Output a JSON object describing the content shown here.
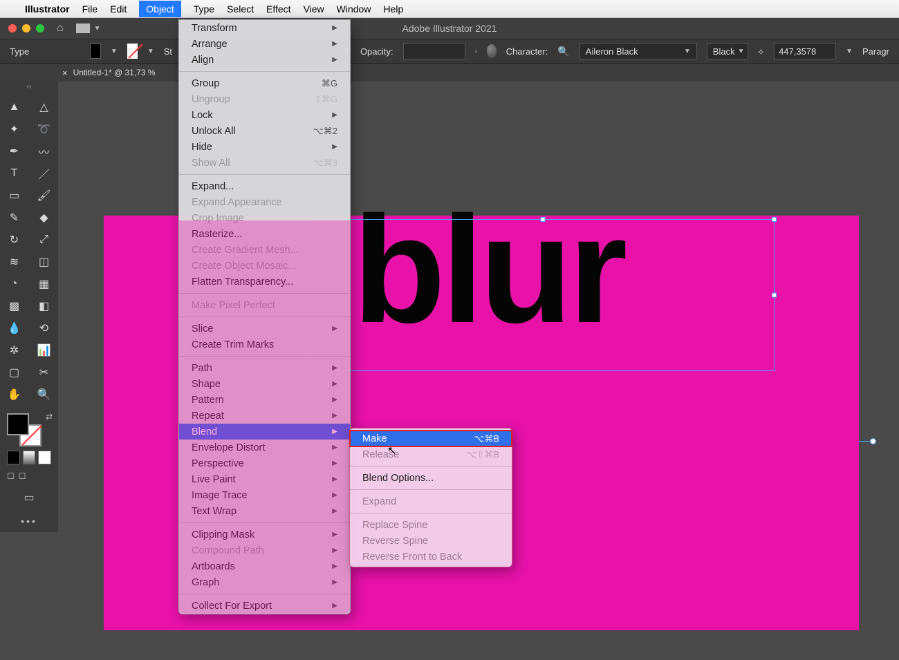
{
  "menubar": {
    "app": "Illustrator",
    "items": [
      "File",
      "Edit",
      "Object",
      "Type",
      "Select",
      "Effect",
      "View",
      "Window",
      "Help"
    ],
    "active": "Object"
  },
  "appbar": {
    "title": "Adobe Illustrator 2021"
  },
  "optbar": {
    "label_type": "Type",
    "stroke_label_cut": "St",
    "opacity_label": "Opacity:",
    "character_label": "Character:",
    "font": "Aileron Black",
    "style": "Black",
    "size": "447,3578",
    "paragraph_label": "Paragr"
  },
  "doctab": {
    "name": "Untitled-1* @ 31,73 %",
    "close": "×"
  },
  "canvas": {
    "text": "blur"
  },
  "object_menu": {
    "g1": [
      {
        "l": "Transform",
        "sub": true
      },
      {
        "l": "Arrange",
        "sub": true
      },
      {
        "l": "Align",
        "sub": true
      }
    ],
    "g2": [
      {
        "l": "Group",
        "sc": "⌘G"
      },
      {
        "l": "Ungroup",
        "sc": "⇧⌘G",
        "dis": true
      },
      {
        "l": "Lock",
        "sub": true
      },
      {
        "l": "Unlock All",
        "sc": "⌥⌘2"
      },
      {
        "l": "Hide",
        "sub": true
      },
      {
        "l": "Show All",
        "sc": "⌥⌘3",
        "dis": true
      }
    ],
    "g3": [
      {
        "l": "Expand..."
      },
      {
        "l": "Expand Appearance",
        "dis": true
      },
      {
        "l": "Crop Image",
        "dis": true
      },
      {
        "l": "Rasterize..."
      },
      {
        "l": "Create Gradient Mesh...",
        "dis": true
      },
      {
        "l": "Create Object Mosaic...",
        "dis": true
      },
      {
        "l": "Flatten Transparency..."
      }
    ],
    "g4": [
      {
        "l": "Make Pixel Perfect",
        "dis": true
      }
    ],
    "g5": [
      {
        "l": "Slice",
        "sub": true
      },
      {
        "l": "Create Trim Marks"
      }
    ],
    "g6": [
      {
        "l": "Path",
        "sub": true
      },
      {
        "l": "Shape",
        "sub": true
      },
      {
        "l": "Pattern",
        "sub": true
      },
      {
        "l": "Repeat",
        "sub": true
      },
      {
        "l": "Blend",
        "sub": true,
        "hov": true
      },
      {
        "l": "Envelope Distort",
        "sub": true
      },
      {
        "l": "Perspective",
        "sub": true
      },
      {
        "l": "Live Paint",
        "sub": true
      },
      {
        "l": "Image Trace",
        "sub": true
      },
      {
        "l": "Text Wrap",
        "sub": true
      }
    ],
    "g7": [
      {
        "l": "Clipping Mask",
        "sub": true
      },
      {
        "l": "Compound Path",
        "sub": true,
        "dis": true
      },
      {
        "l": "Artboards",
        "sub": true
      },
      {
        "l": "Graph",
        "sub": true
      }
    ],
    "g8": [
      {
        "l": "Collect For Export",
        "sub": true
      }
    ]
  },
  "blend_submenu": {
    "g1": [
      {
        "l": "Make",
        "sc": "⌥⌘B",
        "sel": true
      },
      {
        "l": "Release",
        "sc": "⌥⇧⌘B",
        "dis": true
      }
    ],
    "g2": [
      {
        "l": "Blend Options..."
      }
    ],
    "g3": [
      {
        "l": "Expand",
        "dis": true
      }
    ],
    "g4": [
      {
        "l": "Replace Spine",
        "dis": true
      },
      {
        "l": "Reverse Spine",
        "dis": true
      },
      {
        "l": "Reverse Front to Back",
        "dis": true
      }
    ]
  }
}
